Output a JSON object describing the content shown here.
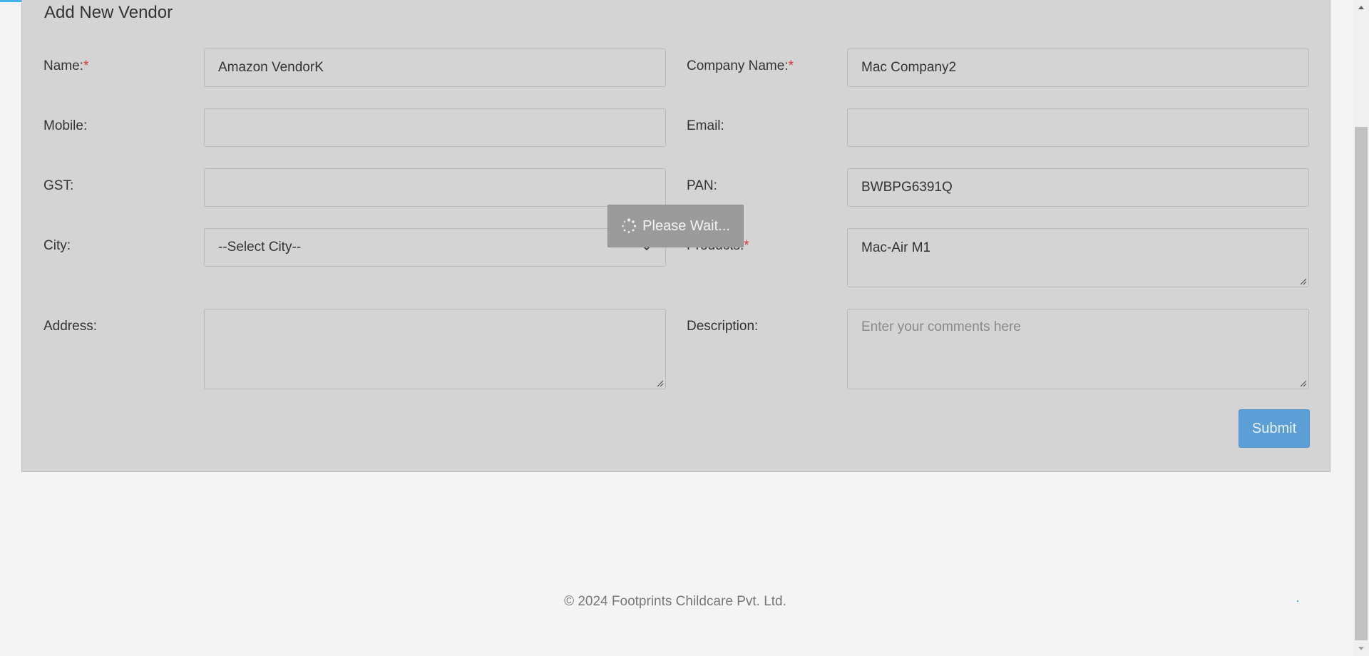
{
  "form": {
    "title": "Add New Vendor",
    "required_mark": "*",
    "name": {
      "label": "Name:",
      "value": "Amazon VendorK"
    },
    "company_name": {
      "label": "Company Name:",
      "value": "Mac Company2"
    },
    "mobile": {
      "label": "Mobile:",
      "value": ""
    },
    "email": {
      "label": "Email:",
      "value": ""
    },
    "gst": {
      "label": "GST:",
      "value": ""
    },
    "pan": {
      "label": "PAN:",
      "value": "BWBPG6391Q"
    },
    "city": {
      "label": "City:",
      "selected": "--Select City--"
    },
    "products": {
      "label": "Products:",
      "value": "Mac-Air M1"
    },
    "address": {
      "label": "Address:",
      "value": ""
    },
    "description": {
      "label": "Description:",
      "placeholder": "Enter your comments here"
    },
    "submit_label": "Submit"
  },
  "loading": {
    "message": "Please Wait...",
    "progress_fraction": 0.34
  },
  "footer": {
    "copyright": "© 2024 Footprints Childcare Pvt. Ltd."
  },
  "colors": {
    "accent": "#3fb3ea",
    "required": "#d9363e",
    "submit": "#5b9fd6"
  }
}
